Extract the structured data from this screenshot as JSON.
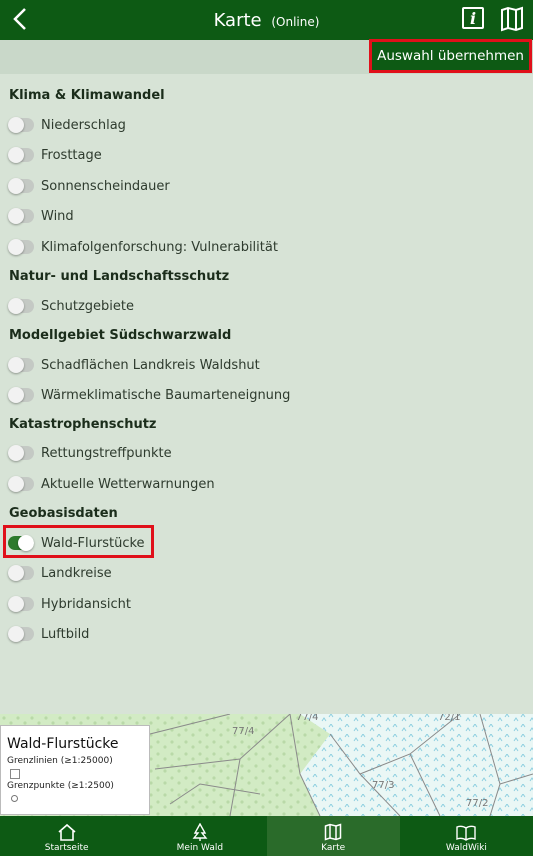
{
  "header": {
    "title": "Karte",
    "subtitle": "(Online)",
    "back_icon": "chevron-left-icon",
    "info_icon": "info-icon",
    "info_glyph": "i",
    "map_icon": "map-icon"
  },
  "apply_button": "Auswahl übernehmen",
  "sections": [
    {
      "title": "Klima & Klimawandel",
      "items": [
        {
          "label": "Niederschlag",
          "on": false
        },
        {
          "label": "Frosttage",
          "on": false
        },
        {
          "label": "Sonnenscheindauer",
          "on": false
        },
        {
          "label": "Wind",
          "on": false
        },
        {
          "label": "Klimafolgenforschung: Vulnerabilität",
          "on": false
        }
      ]
    },
    {
      "title": "Natur- und Landschaftsschutz",
      "items": [
        {
          "label": "Schutzgebiete",
          "on": false
        }
      ]
    },
    {
      "title": "Modellgebiet Südschwarzwald",
      "items": [
        {
          "label": "Schadflächen Landkreis Waldshut",
          "on": false
        },
        {
          "label": "Wärmeklimatische Baumarteneignung",
          "on": false
        }
      ]
    },
    {
      "title": "Katastrophenschutz",
      "items": [
        {
          "label": "Rettungstreffpunkte",
          "on": false
        },
        {
          "label": "Aktuelle Wetterwarnungen",
          "on": false
        }
      ]
    },
    {
      "title": "Geobasisdaten",
      "items": [
        {
          "label": "Wald-Flurstücke",
          "on": true
        },
        {
          "label": "Landkreise",
          "on": false
        },
        {
          "label": "Hybridansicht",
          "on": false
        },
        {
          "label": "Luftbild",
          "on": false
        }
      ]
    }
  ],
  "legend": {
    "title": "Wald-Flurstücke",
    "line1": "Grenzlinien (≥1:25000)",
    "line2": "Grenzpunkte (≥1:2500)"
  },
  "map_labels": [
    "77/4",
    "77/4",
    "72/1",
    "77/3",
    "77/2"
  ],
  "nav": [
    {
      "label": "Startseite",
      "icon": "home-icon",
      "active": false
    },
    {
      "label": "Mein Wald",
      "icon": "tree-icon",
      "active": false
    },
    {
      "label": "Karte",
      "icon": "map-icon",
      "active": true
    },
    {
      "label": "WaldWiki",
      "icon": "book-icon",
      "active": false
    }
  ],
  "colors": {
    "primary": "#0d5a14",
    "background": "#d7e3d6",
    "highlight": "#e0101a",
    "toggle_on": "#2c7a2c"
  }
}
